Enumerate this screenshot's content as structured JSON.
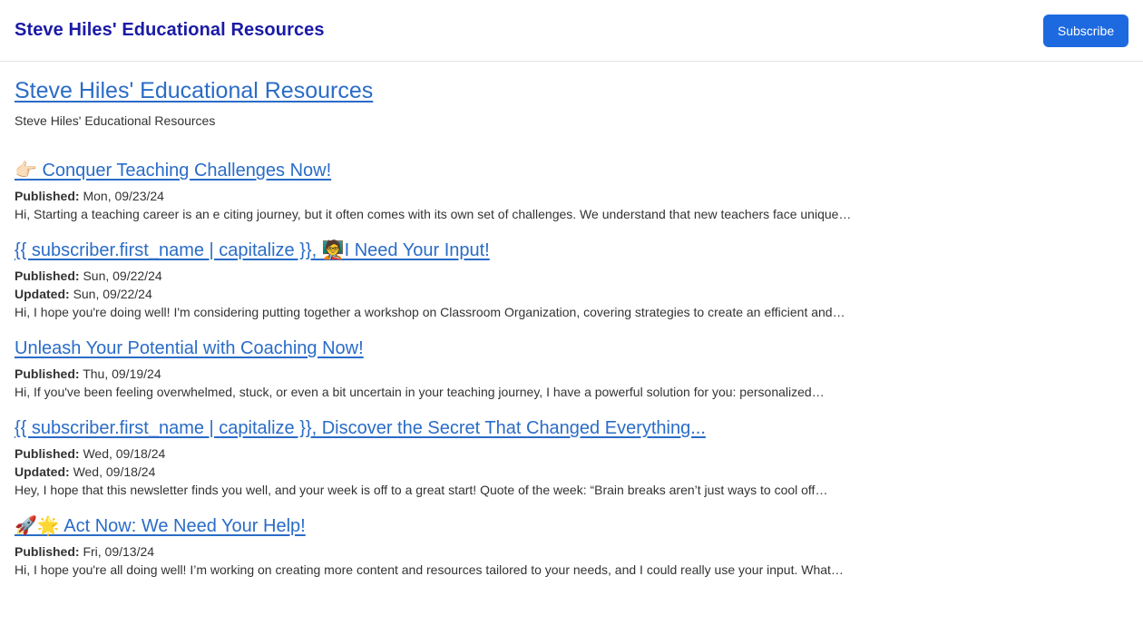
{
  "header": {
    "brand": "Steve Hiles' Educational Resources",
    "subscribe_label": "Subscribe"
  },
  "page": {
    "title": "Steve Hiles' Educational Resources",
    "subtitle": "Steve Hiles' Educational Resources"
  },
  "labels": {
    "published": "Published:",
    "updated": "Updated:"
  },
  "posts": [
    {
      "title": "👉🏻 Conquer Teaching Challenges Now!",
      "published": "Mon, 09/23/24",
      "excerpt": "Hi, Starting a teaching career is an e citing journey, but it often comes with its own set of challenges. We understand that new teachers face unique…"
    },
    {
      "title": "{{ subscriber.first_name | capitalize }}, 🧑‍🏫I Need Your Input!",
      "published": "Sun, 09/22/24",
      "updated": "Sun, 09/22/24",
      "excerpt": "Hi, I hope you're doing well! I'm considering putting together a workshop on Classroom Organization, covering strategies to create an efficient and…"
    },
    {
      "title": "Unleash Your Potential with Coaching Now!",
      "published": "Thu, 09/19/24",
      "excerpt": "Hi, If you've been feeling overwhelmed, stuck, or even a bit uncertain in your teaching journey, I have a powerful solution for you: personalized…"
    },
    {
      "title": "{{ subscriber.first_name | capitalize }}, Discover the Secret That Changed Everything...",
      "published": "Wed, 09/18/24",
      "updated": "Wed, 09/18/24",
      "excerpt": "Hey, I hope that this newsletter finds you well, and your week is off to a great start! Quote of the week: “Brain breaks aren’t just ways to cool off…"
    },
    {
      "title": "🚀🌟 Act Now: We Need Your Help!",
      "published": "Fri, 09/13/24",
      "excerpt": "Hi, I hope you're all doing well! I’m working on creating more content and resources tailored to your needs, and I could really use your input. What…"
    }
  ]
}
